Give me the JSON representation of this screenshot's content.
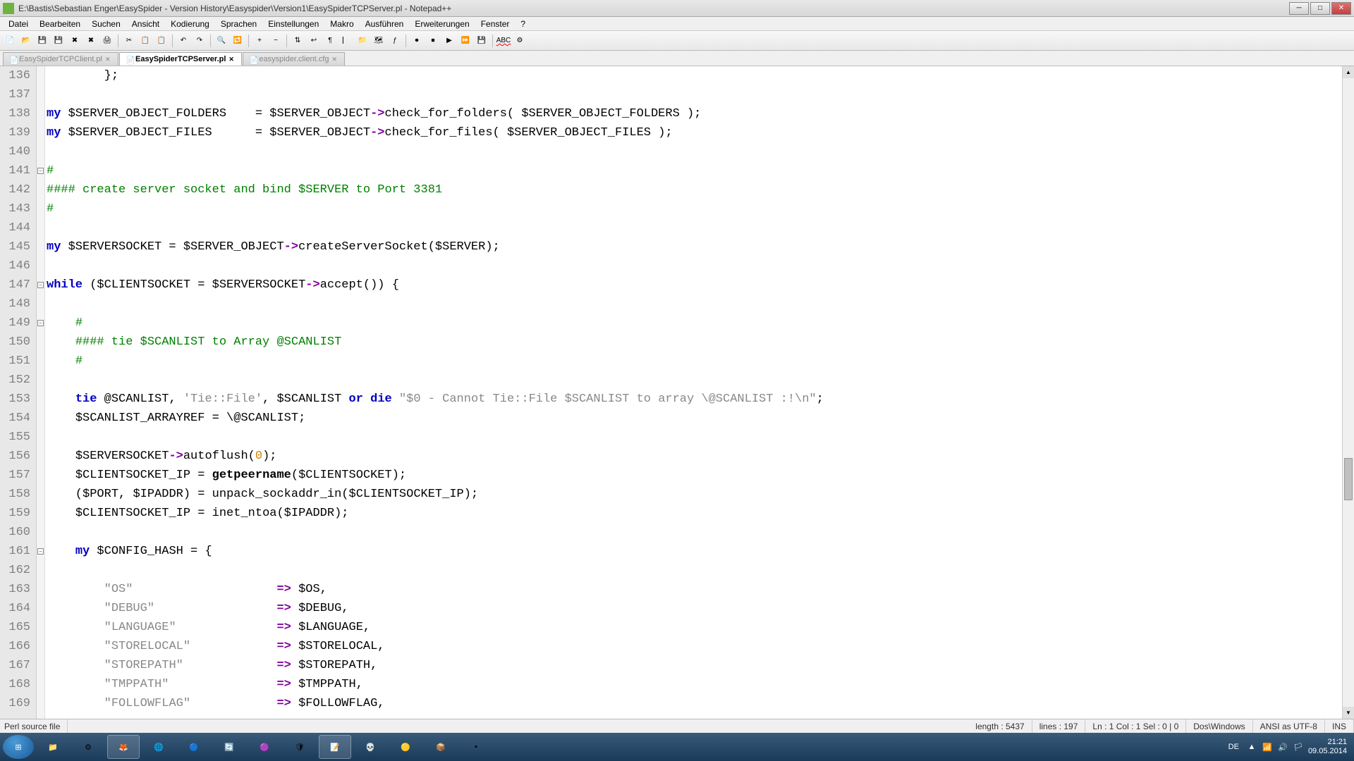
{
  "title": "E:\\Bastis\\Sebastian Enger\\EasySpider - Version History\\Easyspider\\Version1\\EasySpiderTCPServer.pl - Notepad++",
  "menu": [
    "Datei",
    "Bearbeiten",
    "Suchen",
    "Ansicht",
    "Kodierung",
    "Sprachen",
    "Einstellungen",
    "Makro",
    "Ausführen",
    "Erweiterungen",
    "Fenster",
    "?"
  ],
  "tabs": [
    {
      "label": "EasySpiderTCPClient.pl",
      "active": false
    },
    {
      "label": "EasySpiderTCPServer.pl",
      "active": true
    },
    {
      "label": "easyspider.client.cfg",
      "active": false
    }
  ],
  "lines_start": 136,
  "code": [
    {
      "n": 136,
      "segs": [
        {
          "t": "        };",
          "c": ""
        }
      ]
    },
    {
      "n": 137,
      "segs": []
    },
    {
      "n": 138,
      "segs": [
        {
          "t": "my",
          "c": "kw"
        },
        {
          "t": " ",
          "c": ""
        },
        {
          "t": "$SERVER_OBJECT_FOLDERS",
          "c": "scalar"
        },
        {
          "t": "    = ",
          "c": ""
        },
        {
          "t": "$SERVER_OBJECT",
          "c": "scalar"
        },
        {
          "t": "->",
          "c": "arrow"
        },
        {
          "t": "check_for_folders( ",
          "c": ""
        },
        {
          "t": "$SERVER_OBJECT_FOLDERS",
          "c": "scalar"
        },
        {
          "t": " );",
          "c": ""
        }
      ]
    },
    {
      "n": 139,
      "segs": [
        {
          "t": "my",
          "c": "kw"
        },
        {
          "t": " ",
          "c": ""
        },
        {
          "t": "$SERVER_OBJECT_FILES",
          "c": "scalar"
        },
        {
          "t": "      = ",
          "c": ""
        },
        {
          "t": "$SERVER_OBJECT",
          "c": "scalar"
        },
        {
          "t": "->",
          "c": "arrow"
        },
        {
          "t": "check_for_files( ",
          "c": ""
        },
        {
          "t": "$SERVER_OBJECT_FILES",
          "c": "scalar"
        },
        {
          "t": " );",
          "c": ""
        }
      ]
    },
    {
      "n": 140,
      "segs": []
    },
    {
      "n": 141,
      "segs": [
        {
          "t": "#",
          "c": "com"
        }
      ]
    },
    {
      "n": 142,
      "segs": [
        {
          "t": "#### create server socket and bind $SERVER to Port 3381",
          "c": "com"
        }
      ]
    },
    {
      "n": 143,
      "segs": [
        {
          "t": "#",
          "c": "com"
        }
      ]
    },
    {
      "n": 144,
      "segs": []
    },
    {
      "n": 145,
      "segs": [
        {
          "t": "my",
          "c": "kw"
        },
        {
          "t": " ",
          "c": ""
        },
        {
          "t": "$SERVERSOCKET",
          "c": "scalar"
        },
        {
          "t": " = ",
          "c": ""
        },
        {
          "t": "$SERVER_OBJECT",
          "c": "scalar"
        },
        {
          "t": "->",
          "c": "arrow"
        },
        {
          "t": "createServerSocket(",
          "c": ""
        },
        {
          "t": "$SERVER",
          "c": "scalar"
        },
        {
          "t": ");",
          "c": ""
        }
      ]
    },
    {
      "n": 146,
      "segs": []
    },
    {
      "n": 147,
      "segs": [
        {
          "t": "while",
          "c": "kw"
        },
        {
          "t": " (",
          "c": ""
        },
        {
          "t": "$CLIENTSOCKET",
          "c": "scalar"
        },
        {
          "t": " = ",
          "c": ""
        },
        {
          "t": "$SERVERSOCKET",
          "c": "scalar"
        },
        {
          "t": "->",
          "c": "arrow"
        },
        {
          "t": "accept()) {",
          "c": ""
        }
      ]
    },
    {
      "n": 148,
      "segs": []
    },
    {
      "n": 149,
      "segs": [
        {
          "t": "    ",
          "c": ""
        },
        {
          "t": "#",
          "c": "com"
        }
      ]
    },
    {
      "n": 150,
      "segs": [
        {
          "t": "    ",
          "c": ""
        },
        {
          "t": "#### tie $SCANLIST to Array @SCANLIST",
          "c": "com"
        }
      ]
    },
    {
      "n": 151,
      "segs": [
        {
          "t": "    ",
          "c": ""
        },
        {
          "t": "#",
          "c": "com"
        }
      ]
    },
    {
      "n": 152,
      "segs": []
    },
    {
      "n": 153,
      "segs": [
        {
          "t": "    ",
          "c": ""
        },
        {
          "t": "tie",
          "c": "kw"
        },
        {
          "t": " ",
          "c": ""
        },
        {
          "t": "@SCANLIST",
          "c": "scalar"
        },
        {
          "t": ", ",
          "c": ""
        },
        {
          "t": "'Tie::File'",
          "c": "str"
        },
        {
          "t": ", ",
          "c": ""
        },
        {
          "t": "$SCANLIST",
          "c": "scalar"
        },
        {
          "t": " ",
          "c": ""
        },
        {
          "t": "or",
          "c": "kw"
        },
        {
          "t": " ",
          "c": ""
        },
        {
          "t": "die",
          "c": "kw"
        },
        {
          "t": " ",
          "c": ""
        },
        {
          "t": "\"$0 - Cannot Tie::File $SCANLIST to array \\@SCANLIST :!\\n\"",
          "c": "str"
        },
        {
          "t": ";",
          "c": ""
        }
      ]
    },
    {
      "n": 154,
      "segs": [
        {
          "t": "    ",
          "c": ""
        },
        {
          "t": "$SCANLIST_ARRAYREF",
          "c": "scalar"
        },
        {
          "t": " = \\",
          "c": ""
        },
        {
          "t": "@SCANLIST",
          "c": "scalar"
        },
        {
          "t": ";",
          "c": ""
        }
      ]
    },
    {
      "n": 155,
      "segs": []
    },
    {
      "n": 156,
      "segs": [
        {
          "t": "    ",
          "c": ""
        },
        {
          "t": "$SERVERSOCKET",
          "c": "scalar"
        },
        {
          "t": "->",
          "c": "arrow"
        },
        {
          "t": "autoflush(",
          "c": ""
        },
        {
          "t": "0",
          "c": "num"
        },
        {
          "t": ");",
          "c": ""
        }
      ]
    },
    {
      "n": 157,
      "segs": [
        {
          "t": "    ",
          "c": ""
        },
        {
          "t": "$CLIENTSOCKET_IP",
          "c": "scalar"
        },
        {
          "t": " = ",
          "c": ""
        },
        {
          "t": "getpeername",
          "c": "func"
        },
        {
          "t": "(",
          "c": ""
        },
        {
          "t": "$CLIENTSOCKET",
          "c": "scalar"
        },
        {
          "t": ");",
          "c": ""
        }
      ]
    },
    {
      "n": 158,
      "segs": [
        {
          "t": "    (",
          "c": ""
        },
        {
          "t": "$PORT",
          "c": "scalar"
        },
        {
          "t": ", ",
          "c": ""
        },
        {
          "t": "$IPADDR",
          "c": "scalar"
        },
        {
          "t": ") = unpack_sockaddr_in(",
          "c": ""
        },
        {
          "t": "$CLIENTSOCKET_IP",
          "c": "scalar"
        },
        {
          "t": ");",
          "c": ""
        }
      ]
    },
    {
      "n": 159,
      "segs": [
        {
          "t": "    ",
          "c": ""
        },
        {
          "t": "$CLIENTSOCKET_IP",
          "c": "scalar"
        },
        {
          "t": " = inet_ntoa(",
          "c": ""
        },
        {
          "t": "$IPADDR",
          "c": "scalar"
        },
        {
          "t": ");",
          "c": ""
        }
      ]
    },
    {
      "n": 160,
      "segs": []
    },
    {
      "n": 161,
      "segs": [
        {
          "t": "    ",
          "c": ""
        },
        {
          "t": "my",
          "c": "kw"
        },
        {
          "t": " ",
          "c": ""
        },
        {
          "t": "$CONFIG_HASH",
          "c": "scalar"
        },
        {
          "t": " = {",
          "c": ""
        }
      ]
    },
    {
      "n": 162,
      "segs": []
    },
    {
      "n": 163,
      "segs": [
        {
          "t": "        ",
          "c": ""
        },
        {
          "t": "\"OS\"",
          "c": "str"
        },
        {
          "t": "                    ",
          "c": ""
        },
        {
          "t": "=>",
          "c": "op"
        },
        {
          "t": " ",
          "c": ""
        },
        {
          "t": "$OS",
          "c": "scalar"
        },
        {
          "t": ",",
          "c": ""
        }
      ]
    },
    {
      "n": 164,
      "segs": [
        {
          "t": "        ",
          "c": ""
        },
        {
          "t": "\"DEBUG\"",
          "c": "str"
        },
        {
          "t": "                 ",
          "c": ""
        },
        {
          "t": "=>",
          "c": "op"
        },
        {
          "t": " ",
          "c": ""
        },
        {
          "t": "$DEBUG",
          "c": "scalar"
        },
        {
          "t": ",",
          "c": ""
        }
      ]
    },
    {
      "n": 165,
      "segs": [
        {
          "t": "        ",
          "c": ""
        },
        {
          "t": "\"LANGUAGE\"",
          "c": "str"
        },
        {
          "t": "              ",
          "c": ""
        },
        {
          "t": "=>",
          "c": "op"
        },
        {
          "t": " ",
          "c": ""
        },
        {
          "t": "$LANGUAGE",
          "c": "scalar"
        },
        {
          "t": ",",
          "c": ""
        }
      ]
    },
    {
      "n": 166,
      "segs": [
        {
          "t": "        ",
          "c": ""
        },
        {
          "t": "\"STORELOCAL\"",
          "c": "str"
        },
        {
          "t": "            ",
          "c": ""
        },
        {
          "t": "=>",
          "c": "op"
        },
        {
          "t": " ",
          "c": ""
        },
        {
          "t": "$STORELOCAL",
          "c": "scalar"
        },
        {
          "t": ",",
          "c": ""
        }
      ]
    },
    {
      "n": 167,
      "segs": [
        {
          "t": "        ",
          "c": ""
        },
        {
          "t": "\"STOREPATH\"",
          "c": "str"
        },
        {
          "t": "             ",
          "c": ""
        },
        {
          "t": "=>",
          "c": "op"
        },
        {
          "t": " ",
          "c": ""
        },
        {
          "t": "$STOREPATH",
          "c": "scalar"
        },
        {
          "t": ",",
          "c": ""
        }
      ]
    },
    {
      "n": 168,
      "segs": [
        {
          "t": "        ",
          "c": ""
        },
        {
          "t": "\"TMPPATH\"",
          "c": "str"
        },
        {
          "t": "               ",
          "c": ""
        },
        {
          "t": "=>",
          "c": "op"
        },
        {
          "t": " ",
          "c": ""
        },
        {
          "t": "$TMPPATH",
          "c": "scalar"
        },
        {
          "t": ",",
          "c": ""
        }
      ]
    },
    {
      "n": 169,
      "segs": [
        {
          "t": "        ",
          "c": ""
        },
        {
          "t": "\"FOLLOWFLAG\"",
          "c": "str"
        },
        {
          "t": "            ",
          "c": ""
        },
        {
          "t": "=>",
          "c": "op"
        },
        {
          "t": " ",
          "c": ""
        },
        {
          "t": "$FOLLOWFLAG",
          "c": "scalar"
        },
        {
          "t": ",",
          "c": ""
        }
      ]
    }
  ],
  "folds": [
    141,
    147,
    149,
    161
  ],
  "status": {
    "type": "Perl source file",
    "length": "length : 5437",
    "lines": "lines : 197",
    "pos": "Ln : 1   Col : 1   Sel : 0 | 0",
    "eol": "Dos\\Windows",
    "enc": "ANSI as UTF-8",
    "ins": "INS"
  },
  "tray": {
    "lang": "DE",
    "time": "21:21",
    "date": "09.05.2014"
  }
}
